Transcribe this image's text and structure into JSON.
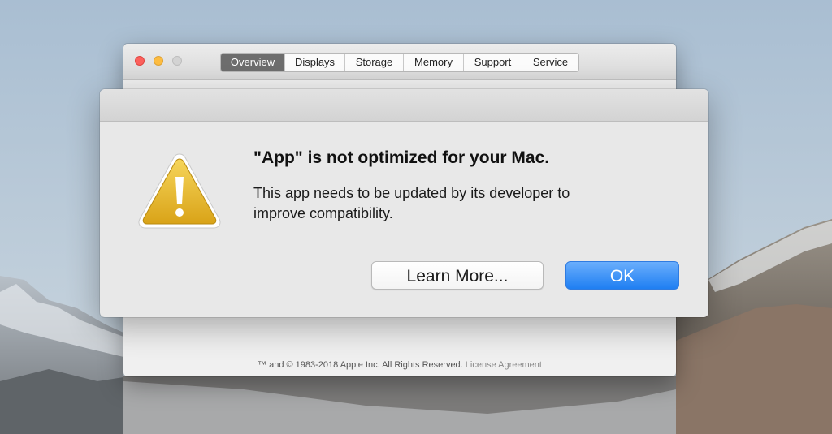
{
  "about_window": {
    "tabs": [
      {
        "label": "Overview",
        "active": true
      },
      {
        "label": "Displays",
        "active": false
      },
      {
        "label": "Storage",
        "active": false
      },
      {
        "label": "Memory",
        "active": false
      },
      {
        "label": "Support",
        "active": false
      },
      {
        "label": "Service",
        "active": false
      }
    ],
    "footer_copyright": "™ and © 1983-2018 Apple Inc. All Rights Reserved.",
    "footer_link": "License Agreement"
  },
  "alert": {
    "icon": "warning-icon",
    "title": "\"App\" is not optimized for your Mac.",
    "message_line1": "This app needs to be updated by its developer to",
    "message_line2": "improve compatibility.",
    "learn_more_label": "Learn More...",
    "ok_label": "OK"
  },
  "colors": {
    "accent_blue": "#1f7ff2",
    "close": "#fc605c",
    "minimize": "#fdbc40",
    "warning_yellow": "#e9b92a"
  }
}
